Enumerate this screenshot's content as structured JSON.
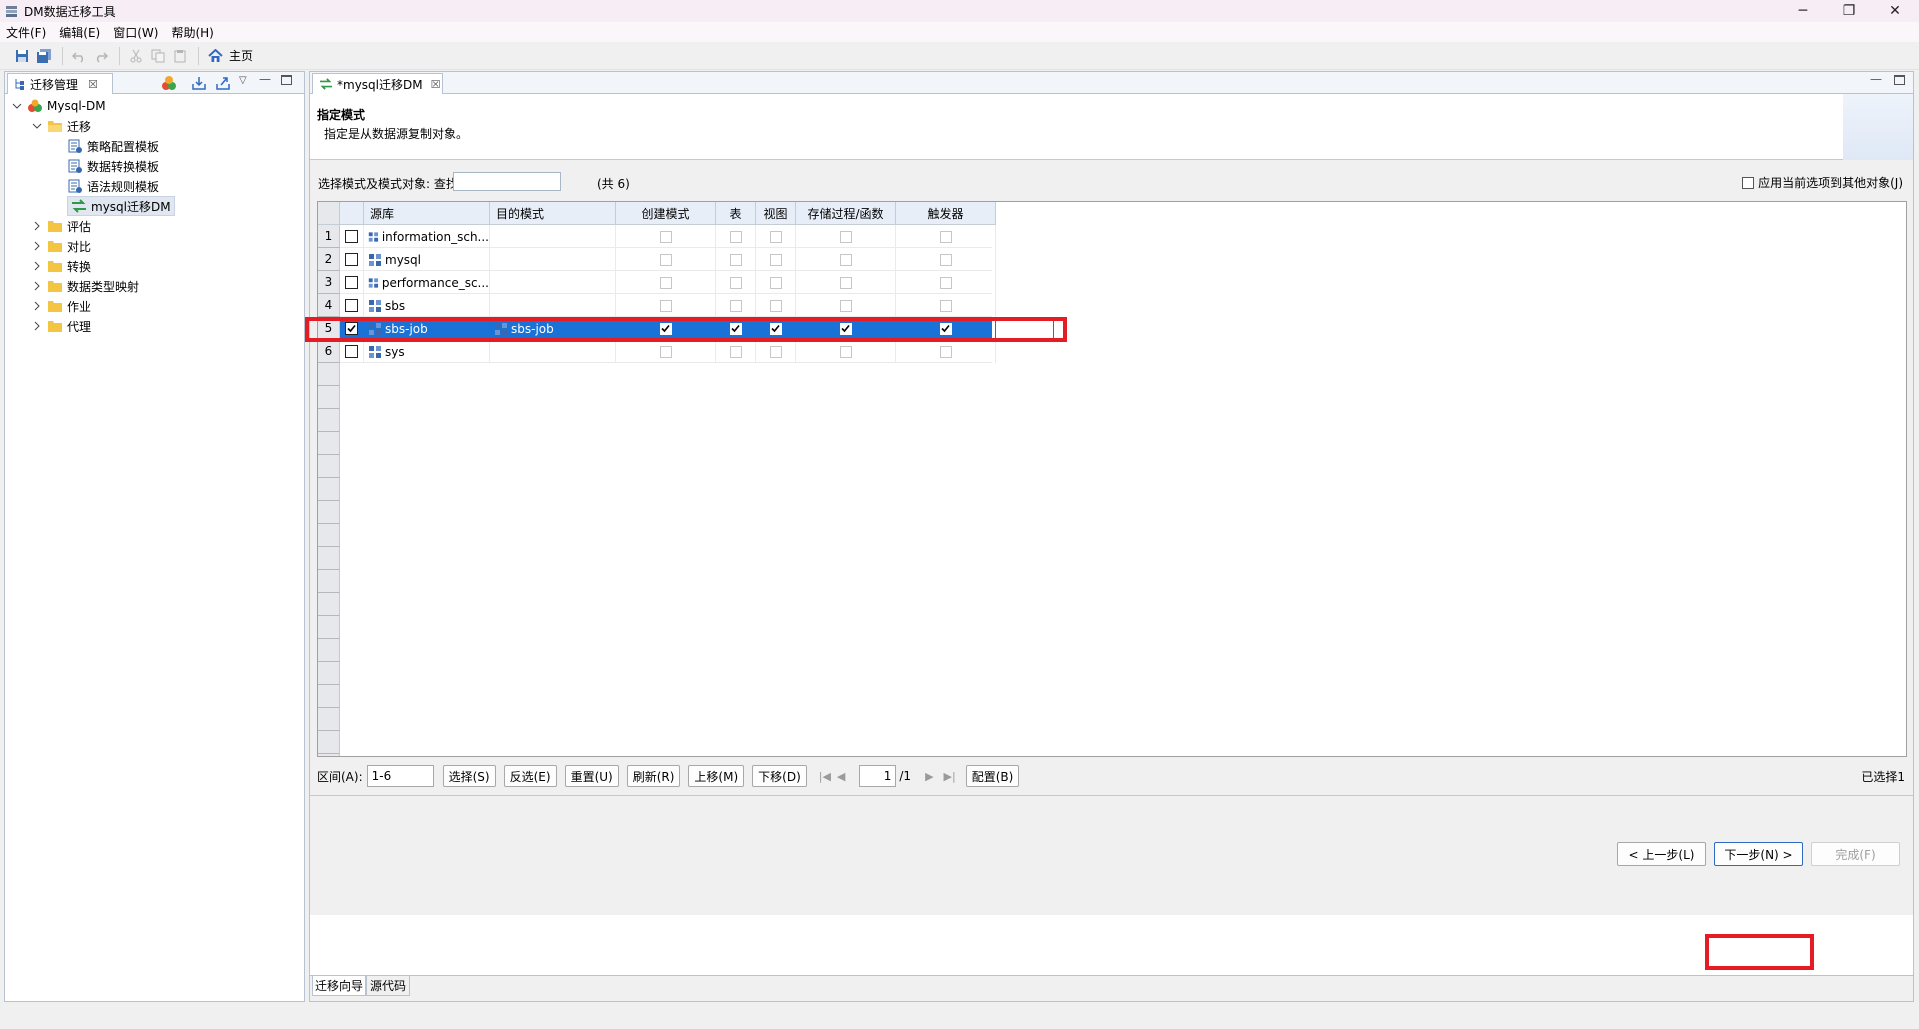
{
  "window": {
    "title": "DM数据迁移工具",
    "minimize": "─",
    "restore": "❐",
    "close": "✕"
  },
  "menu": [
    "文件(F)",
    "编辑(E)",
    "窗口(W)",
    "帮助(H)"
  ],
  "toolbar": {
    "home_label": "主页"
  },
  "left_panel": {
    "tab_label": "迁移管理",
    "tree": {
      "root": "Mysql-DM",
      "migration": "迁移",
      "migration_children": [
        "策略配置模板",
        "数据转换模板",
        "语法规则模板",
        "mysql迁移DM"
      ],
      "others": [
        "评估",
        "对比",
        "转换",
        "数据类型映射",
        "作业",
        "代理"
      ]
    }
  },
  "editor": {
    "tab_label": "*mysql迁移DM",
    "header_title": "指定模式",
    "header_desc": "指定是从数据源复制对象。",
    "filter_label": "选择模式及模式对象: 查找(F):",
    "search_value": "",
    "count_label": "(共 6)",
    "apply_other_label": "应用当前选项到其他对象(J)",
    "columns": [
      "源库",
      "目的模式",
      "创建模式",
      "表",
      "视图",
      "存储过程/函数",
      "触发器"
    ],
    "rows": [
      {
        "num": "1",
        "source": "information_sch...",
        "target": "",
        "checked": false
      },
      {
        "num": "2",
        "source": "mysql",
        "target": "",
        "checked": false
      },
      {
        "num": "3",
        "source": "performance_sc...",
        "target": "",
        "checked": false
      },
      {
        "num": "4",
        "source": "sbs",
        "target": "",
        "checked": false
      },
      {
        "num": "5",
        "source": "sbs-job",
        "target": "sbs-job",
        "checked": true
      },
      {
        "num": "6",
        "source": "sys",
        "target": "",
        "checked": false
      }
    ],
    "pager": {
      "range_label": "区间(A):",
      "range_value": "1-6",
      "buttons": [
        "选择(S)",
        "反选(E)",
        "重置(U)",
        "刷新(R)",
        "上移(M)",
        "下移(D)"
      ],
      "page_value": "1",
      "page_total": "/1",
      "config_button": "配置(B)",
      "selected_text": "已选择1"
    },
    "wizard": {
      "prev": "< 上一步(L)",
      "next": "下一步(N) >",
      "finish": "完成(F)"
    },
    "bottom_tabs": [
      "迁移向导",
      "源代码"
    ]
  }
}
